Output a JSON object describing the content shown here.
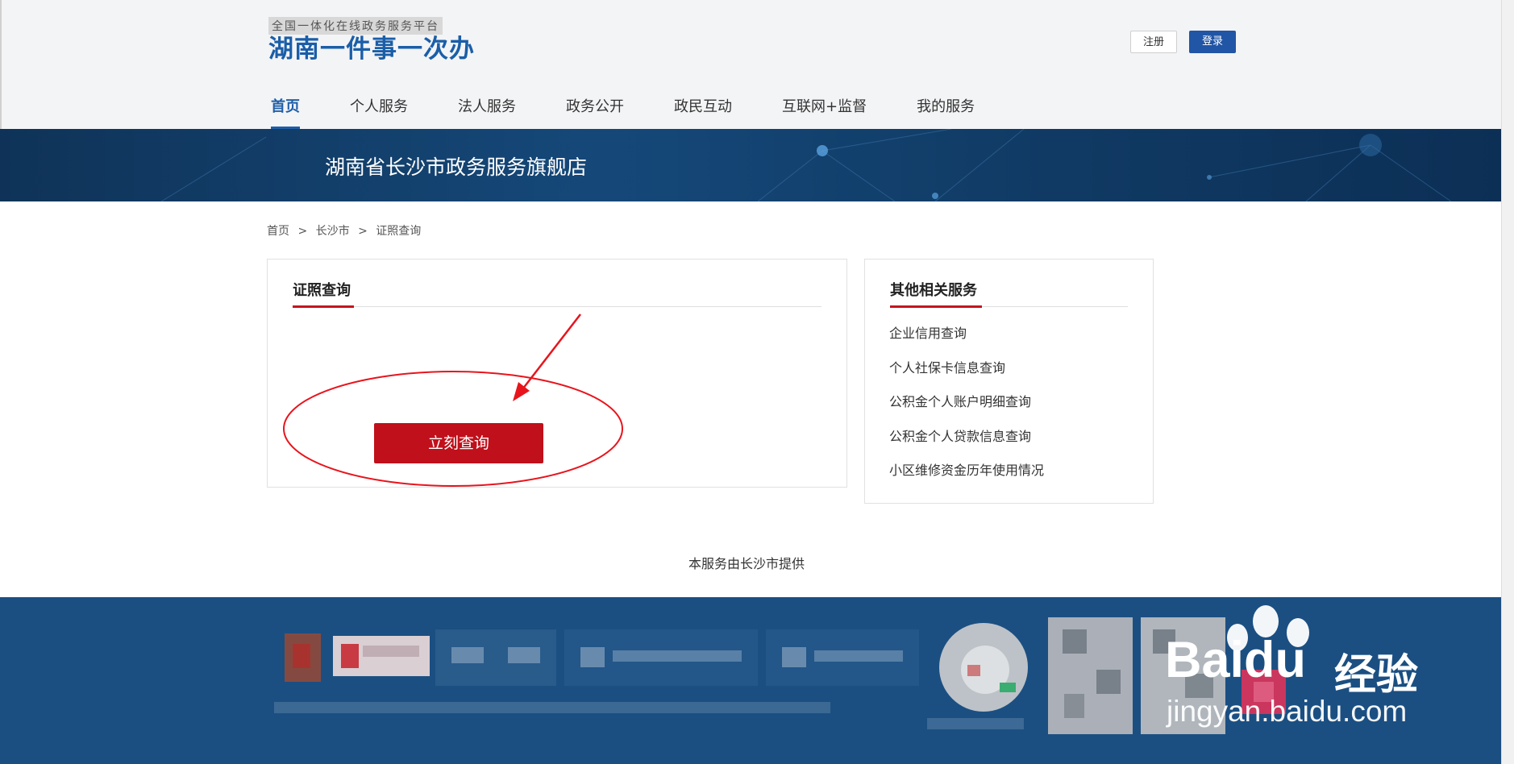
{
  "header": {
    "platform_tag": "全国一体化在线政务服务平台",
    "brand": "湖南一件事一次办",
    "register_label": "注册",
    "login_label": "登录",
    "nav": [
      {
        "label": "首页",
        "active": true
      },
      {
        "label": "个人服务"
      },
      {
        "label": "法人服务"
      },
      {
        "label": "政务公开"
      },
      {
        "label": "政民互动"
      },
      {
        "label": "互联网+监督"
      },
      {
        "label": "我的服务"
      }
    ]
  },
  "banner": {
    "title": "湖南省长沙市政务服务旗舰店"
  },
  "breadcrumb": [
    "首页",
    ">",
    "长沙市",
    ">",
    "证照查询"
  ],
  "main": {
    "title": "证照查询",
    "query_button": "立刻查询"
  },
  "sidebar": {
    "title": "其他相关服务",
    "items": [
      "企业信用查询",
      "个人社保卡信息查询",
      "公积金个人账户明细查询",
      "公积金个人贷款信息查询",
      "小区维修资金历年使用情况"
    ]
  },
  "provided_by": "本服务由长沙市提供",
  "watermark": {
    "brand": "Baidu",
    "cn": "经验",
    "url": "jingyan.baidu.com"
  },
  "colors": {
    "accent_blue": "#1f5ea8",
    "accent_red": "#c0101b",
    "footer_blue": "#1b4f82"
  }
}
